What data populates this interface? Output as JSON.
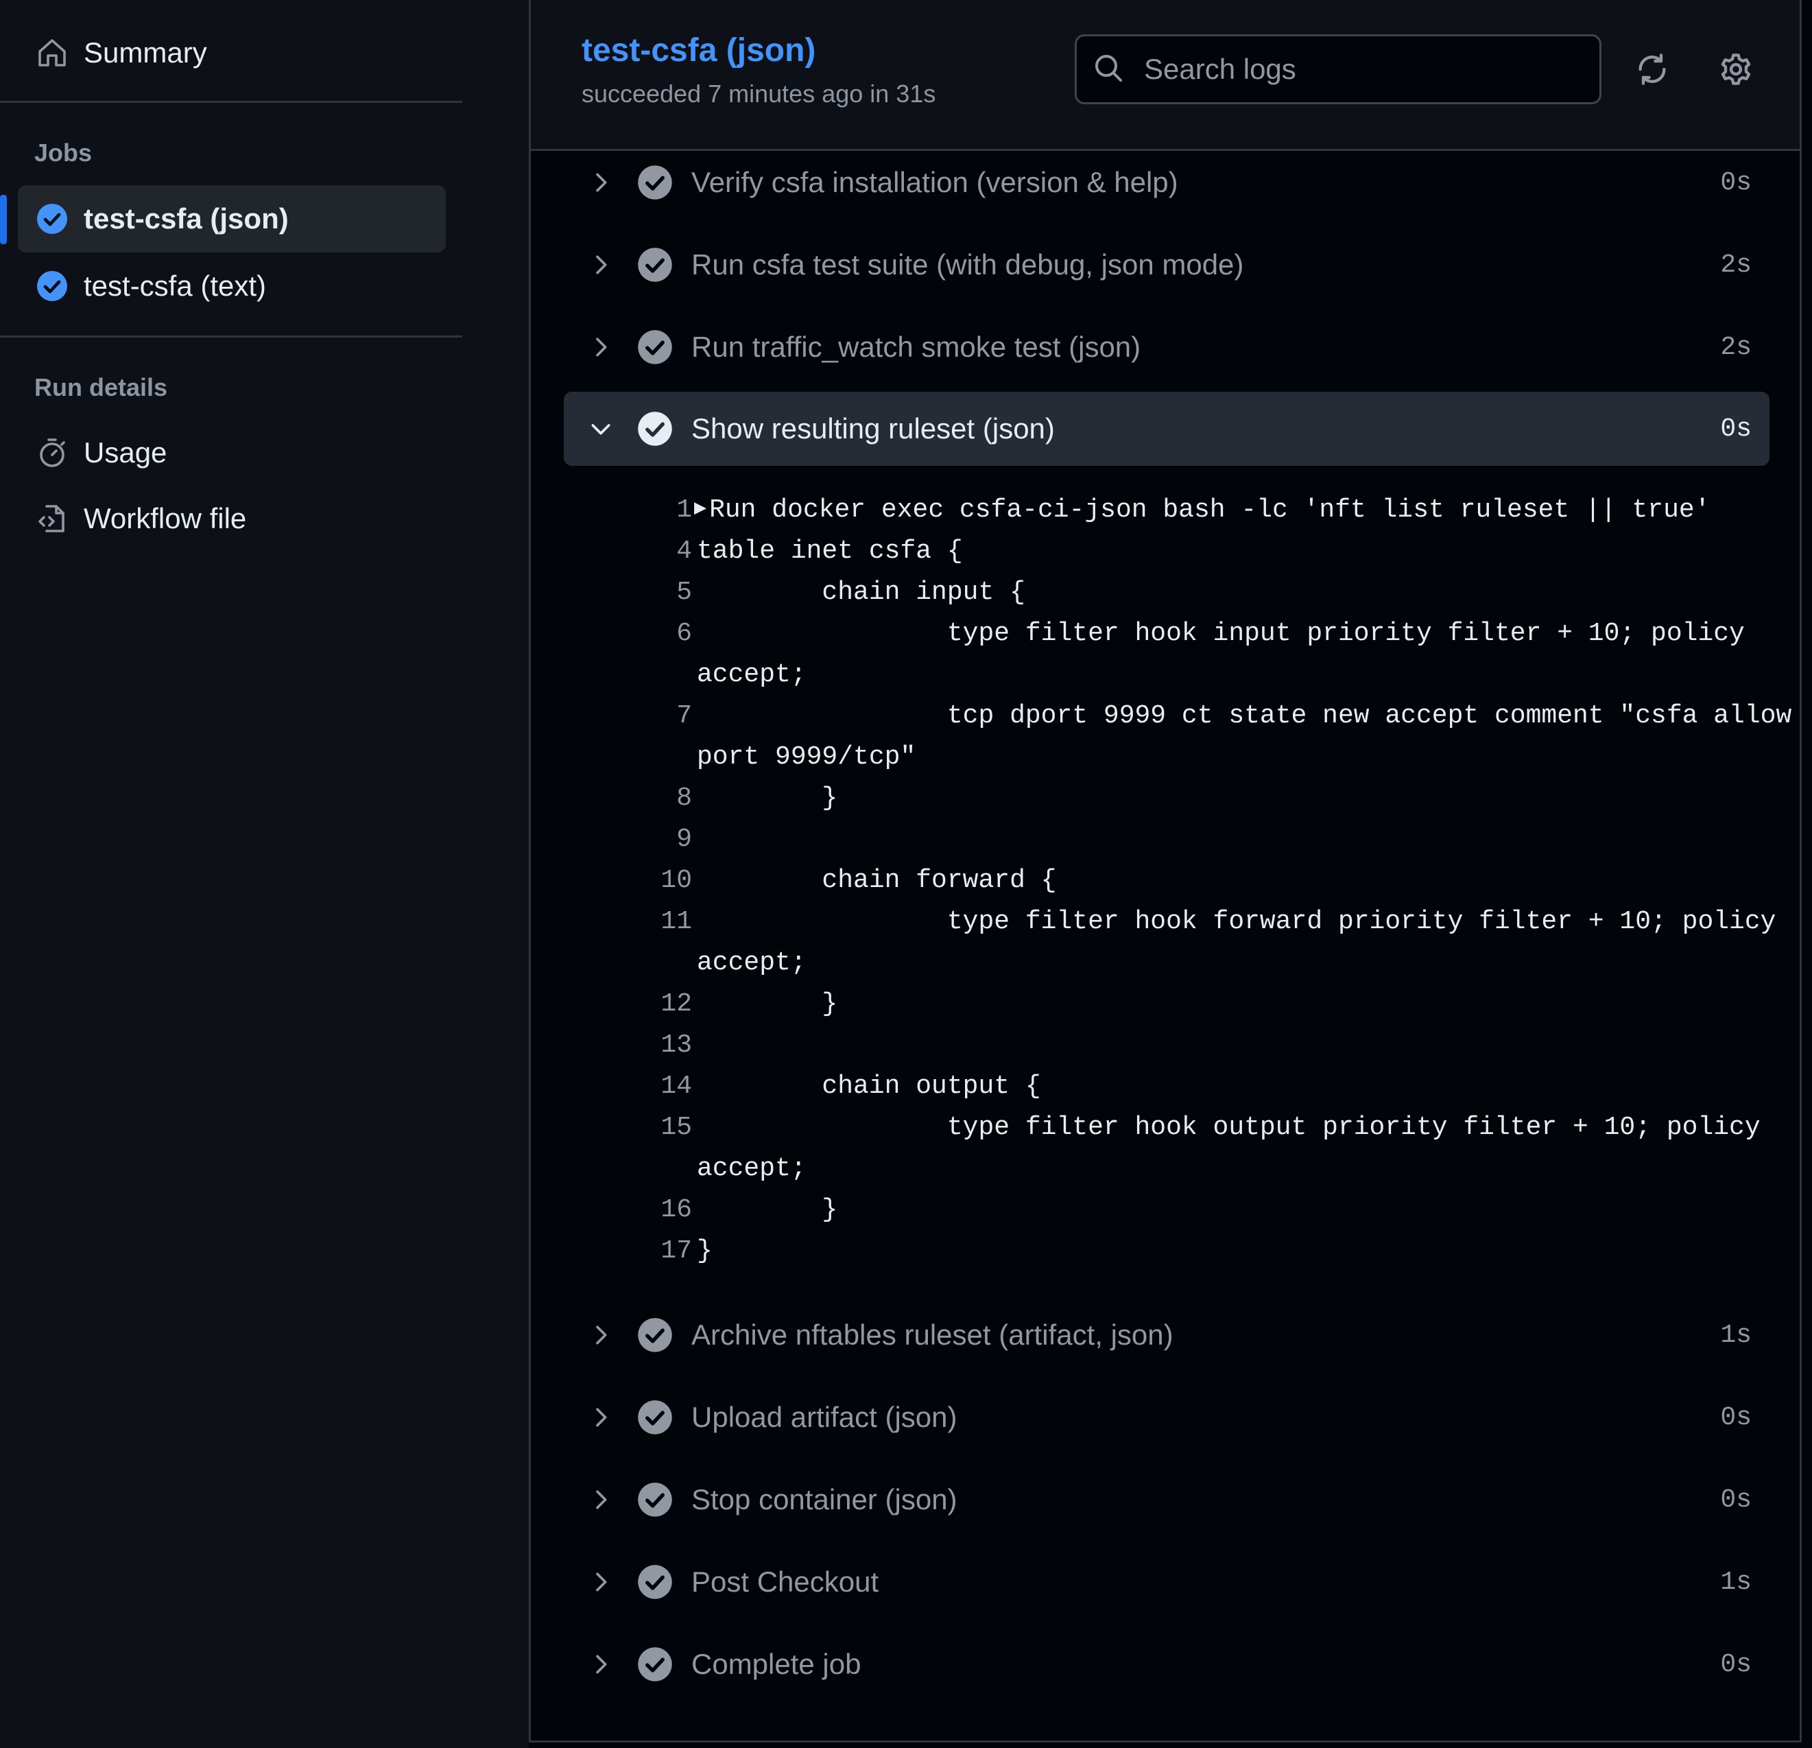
{
  "sidebar": {
    "summary_label": "Summary",
    "jobs_heading": "Jobs",
    "jobs": [
      {
        "label": "test-csfa (json)",
        "status": "success",
        "active": true
      },
      {
        "label": "test-csfa (text)",
        "status": "success",
        "active": false
      }
    ],
    "run_details_heading": "Run details",
    "usage_label": "Usage",
    "workflow_file_label": "Workflow file"
  },
  "header": {
    "title": "test-csfa (json)",
    "subtitle": "succeeded 7 minutes ago in 31s",
    "search_placeholder": "Search logs"
  },
  "steps_before": [
    {
      "name": "Verify csfa installation (version & help)",
      "duration": "0s"
    },
    {
      "name": "Run csfa test suite (with debug, json mode)",
      "duration": "2s"
    },
    {
      "name": "Run traffic_watch smoke test (json)",
      "duration": "2s"
    }
  ],
  "open_step": {
    "name": "Show resulting ruleset (json)",
    "duration": "0s"
  },
  "log": {
    "l1": {
      "n": "1",
      "t": "Run docker exec csfa-ci-json bash -lc 'nft list ruleset || true'"
    },
    "l4": {
      "n": "4",
      "t": "table inet csfa {"
    },
    "l5": {
      "n": "5",
      "t": "        chain input {"
    },
    "l6": {
      "n": "6",
      "t": "                type filter hook input priority filter + 10; policy",
      "c": "accept;"
    },
    "l7": {
      "n": "7",
      "t": "                tcp dport 9999 ct state new accept comment \"csfa allow",
      "c": "port 9999/tcp\""
    },
    "l8": {
      "n": "8",
      "t": "        }"
    },
    "l9": {
      "n": "9",
      "t": ""
    },
    "l10": {
      "n": "10",
      "t": "        chain forward {"
    },
    "l11": {
      "n": "11",
      "t": "                type filter hook forward priority filter + 10; policy",
      "c": "accept;"
    },
    "l12": {
      "n": "12",
      "t": "        }"
    },
    "l13": {
      "n": "13",
      "t": ""
    },
    "l14": {
      "n": "14",
      "t": "        chain output {"
    },
    "l15": {
      "n": "15",
      "t": "                type filter hook output priority filter + 10; policy",
      "c": "accept;"
    },
    "l16": {
      "n": "16",
      "t": "        }"
    },
    "l17": {
      "n": "17",
      "t": "}"
    }
  },
  "steps_after": [
    {
      "name": "Archive nftables ruleset (artifact, json)",
      "duration": "1s"
    },
    {
      "name": "Upload artifact (json)",
      "duration": "0s"
    },
    {
      "name": "Stop container (json)",
      "duration": "0s"
    },
    {
      "name": "Post Checkout",
      "duration": "1s"
    },
    {
      "name": "Complete job",
      "duration": "0s"
    }
  ],
  "colors": {
    "accent": "#4493f8",
    "success_job": "#4493f8",
    "step_check": "#9198a1"
  }
}
